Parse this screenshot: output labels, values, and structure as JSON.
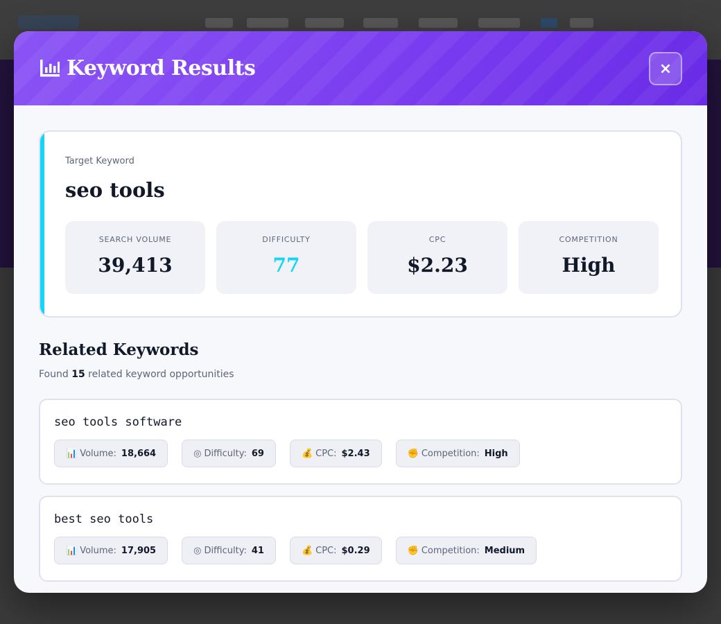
{
  "modal": {
    "title": "Keyword Results",
    "title_icon": "bar-chart-icon",
    "close_label": "×"
  },
  "target": {
    "label": "Target Keyword",
    "keyword": "seo tools",
    "stats": [
      {
        "label": "SEARCH VOLUME",
        "value": "39,413"
      },
      {
        "label": "DIFFICULTY",
        "value": "77",
        "color": "#15d4f5"
      },
      {
        "label": "CPC",
        "value": "$2.23"
      },
      {
        "label": "COMPETITION",
        "value": "High"
      }
    ]
  },
  "related": {
    "title": "Related Keywords",
    "found_prefix": "Found",
    "count": "15",
    "found_suffix": "related keyword opportunities",
    "items": [
      {
        "keyword": "seo tools software",
        "volume_label": "Volume:",
        "volume": "18,664",
        "difficulty_label": "Difficulty:",
        "difficulty": "69",
        "cpc_label": "CPC:",
        "cpc": "$2.43",
        "competition_label": "Competition:",
        "competition": "High"
      },
      {
        "keyword": "best seo tools",
        "volume_label": "Volume:",
        "volume": "17,905",
        "difficulty_label": "Difficulty:",
        "difficulty": "41",
        "cpc_label": "CPC:",
        "cpc": "$0.29",
        "competition_label": "Competition:",
        "competition": "Medium"
      }
    ]
  },
  "icons": {
    "volume": "bar-chart-icon",
    "difficulty": "target-icon",
    "cpc": "money-bag-icon",
    "competition": "fist-icon"
  },
  "colors": {
    "header_gradient_start": "#8a53f5",
    "header_gradient_end": "#6a2be6",
    "accent": "#15d4f5",
    "text_dark": "#111827",
    "text_muted": "#5d6578"
  }
}
